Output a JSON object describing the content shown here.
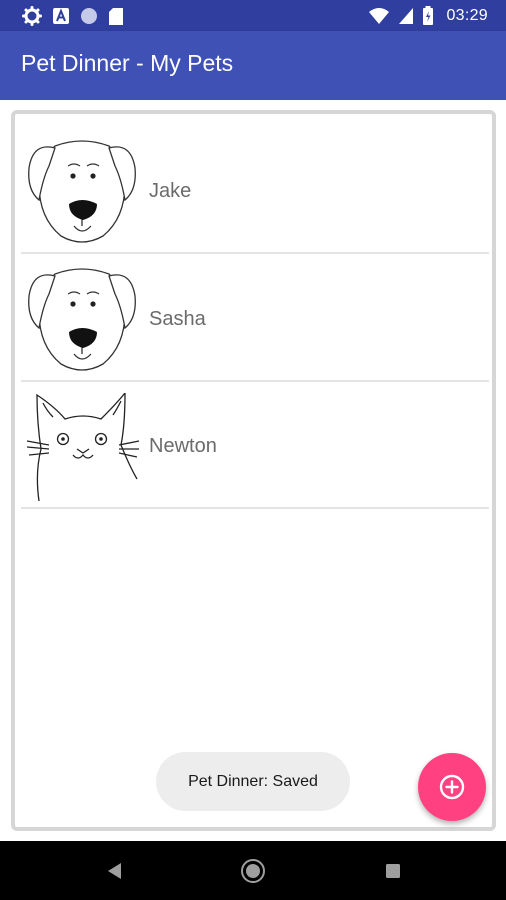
{
  "status_bar": {
    "time": "03:29",
    "left_icons": [
      "gear-icon",
      "a-icon",
      "circle-icon",
      "sd-card-icon"
    ],
    "right_icons": [
      "wifi-icon",
      "signal-icon",
      "battery-icon"
    ]
  },
  "app_bar": {
    "title": "Pet Dinner - My Pets"
  },
  "pets": [
    {
      "name": "Jake",
      "icon": "dog-icon"
    },
    {
      "name": "Sasha",
      "icon": "dog-icon"
    },
    {
      "name": "Newton",
      "icon": "cat-icon"
    }
  ],
  "toast": {
    "text": "Pet Dinner: Saved"
  },
  "fab": {
    "icon": "add-circle-icon"
  },
  "nav_bar": {
    "icons": [
      "back-icon",
      "home-icon",
      "recents-icon"
    ]
  },
  "colors": {
    "status_bar": "#303f9f",
    "app_bar": "#3f51b5",
    "fab": "#ff4081",
    "nav_bar": "#000000"
  }
}
